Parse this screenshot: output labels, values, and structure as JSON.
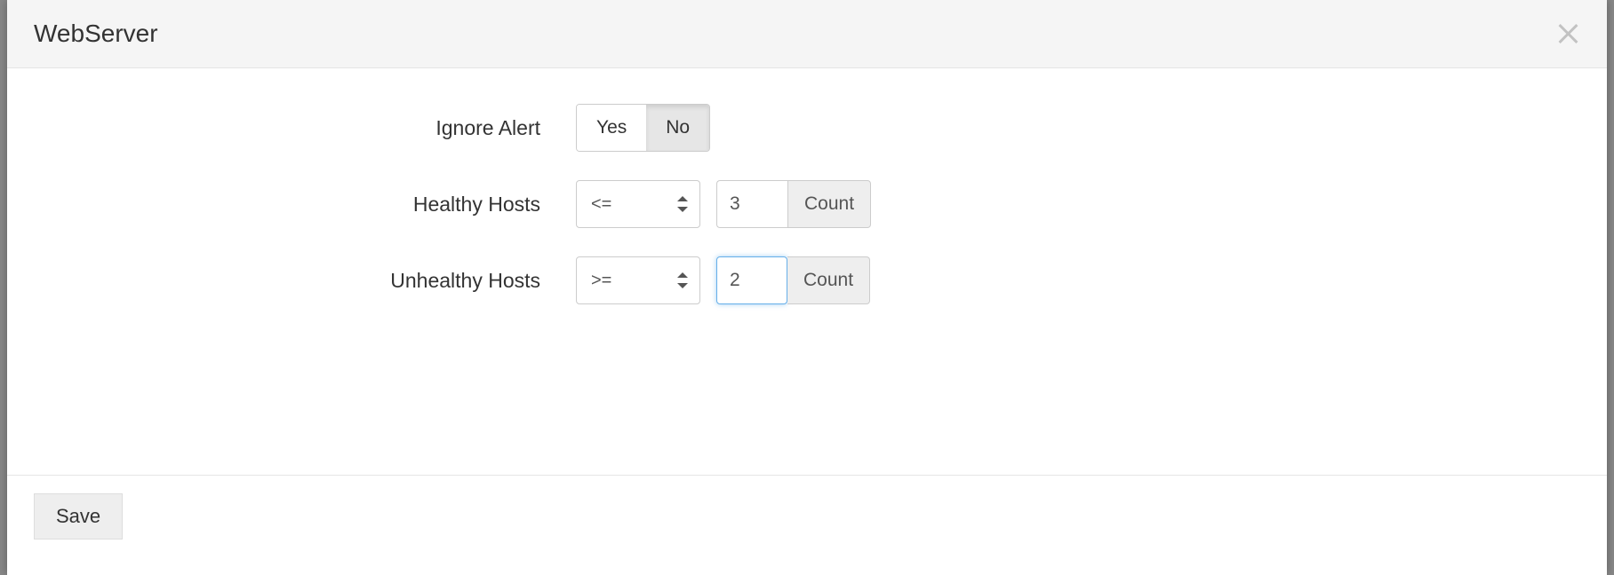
{
  "header": {
    "title": "WebServer"
  },
  "form": {
    "ignore_alert": {
      "label": "Ignore Alert",
      "option_yes": "Yes",
      "option_no": "No",
      "selected": "No"
    },
    "healthy_hosts": {
      "label": "Healthy Hosts",
      "operator": "<=",
      "value": "3",
      "unit": "Count"
    },
    "unhealthy_hosts": {
      "label": "Unhealthy Hosts",
      "operator": ">=",
      "value": "2",
      "unit": "Count"
    }
  },
  "footer": {
    "save_label": "Save"
  }
}
